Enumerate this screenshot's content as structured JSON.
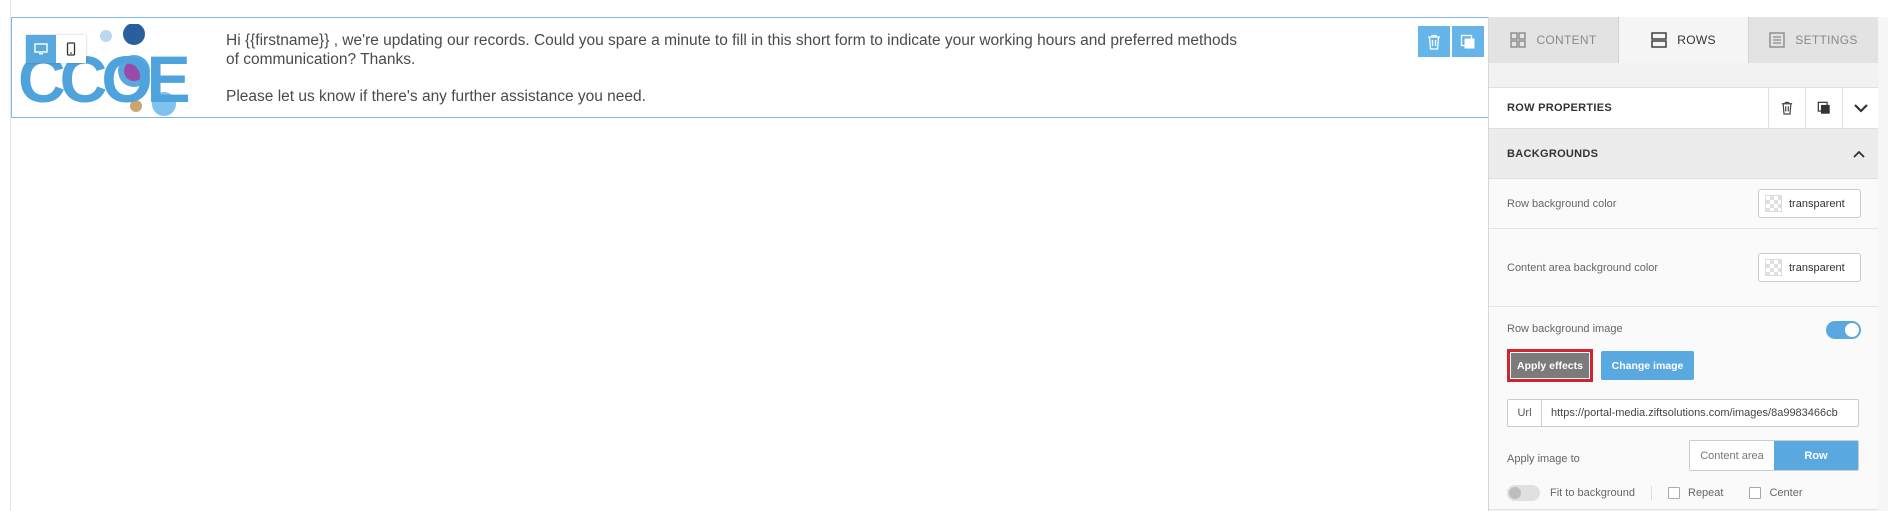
{
  "row": {
    "text_line1": "Hi {{firstname}} , we're updating our records. Could you spare a minute to fill in this short form to indicate your working hours and preferred methods of communication? Thanks.",
    "text_line2": "Please let us know if there's any further assistance you need.",
    "logo_alt": "CCOE"
  },
  "toolbar": {
    "desktop_icon": "desktop-icon",
    "mobile_icon": "mobile-icon",
    "move_icon": "move-icon",
    "delete_icon": "trash-icon",
    "duplicate_icon": "duplicate-icon"
  },
  "panel": {
    "tabs": [
      {
        "label": "CONTENT",
        "icon": "grid-icon"
      },
      {
        "label": "ROWS",
        "icon": "rows-icon",
        "active": true
      },
      {
        "label": "SETTINGS",
        "icon": "settings-icon"
      }
    ],
    "props_title": "ROW PROPERTIES",
    "section_title": "BACKGROUNDS",
    "row_bg_label": "Row background color",
    "row_bg_value": "transparent",
    "content_bg_label": "Content area background color",
    "content_bg_value": "transparent",
    "bg_image_label": "Row background image",
    "apply_effects": "Apply effects",
    "change_image": "Change image",
    "url_prefix": "Url",
    "url_value": "https://portal-media.ziftsolutions.com/images/8a9983466cb",
    "apply_to_label": "Apply image to",
    "apply_to_options": [
      "Content area",
      "Row"
    ],
    "fit_label": "Fit to background",
    "repeat_label": "Repeat",
    "center_label": "Center"
  },
  "colors": {
    "accent": "#5aa8e0",
    "highlight": "#d0242f"
  }
}
